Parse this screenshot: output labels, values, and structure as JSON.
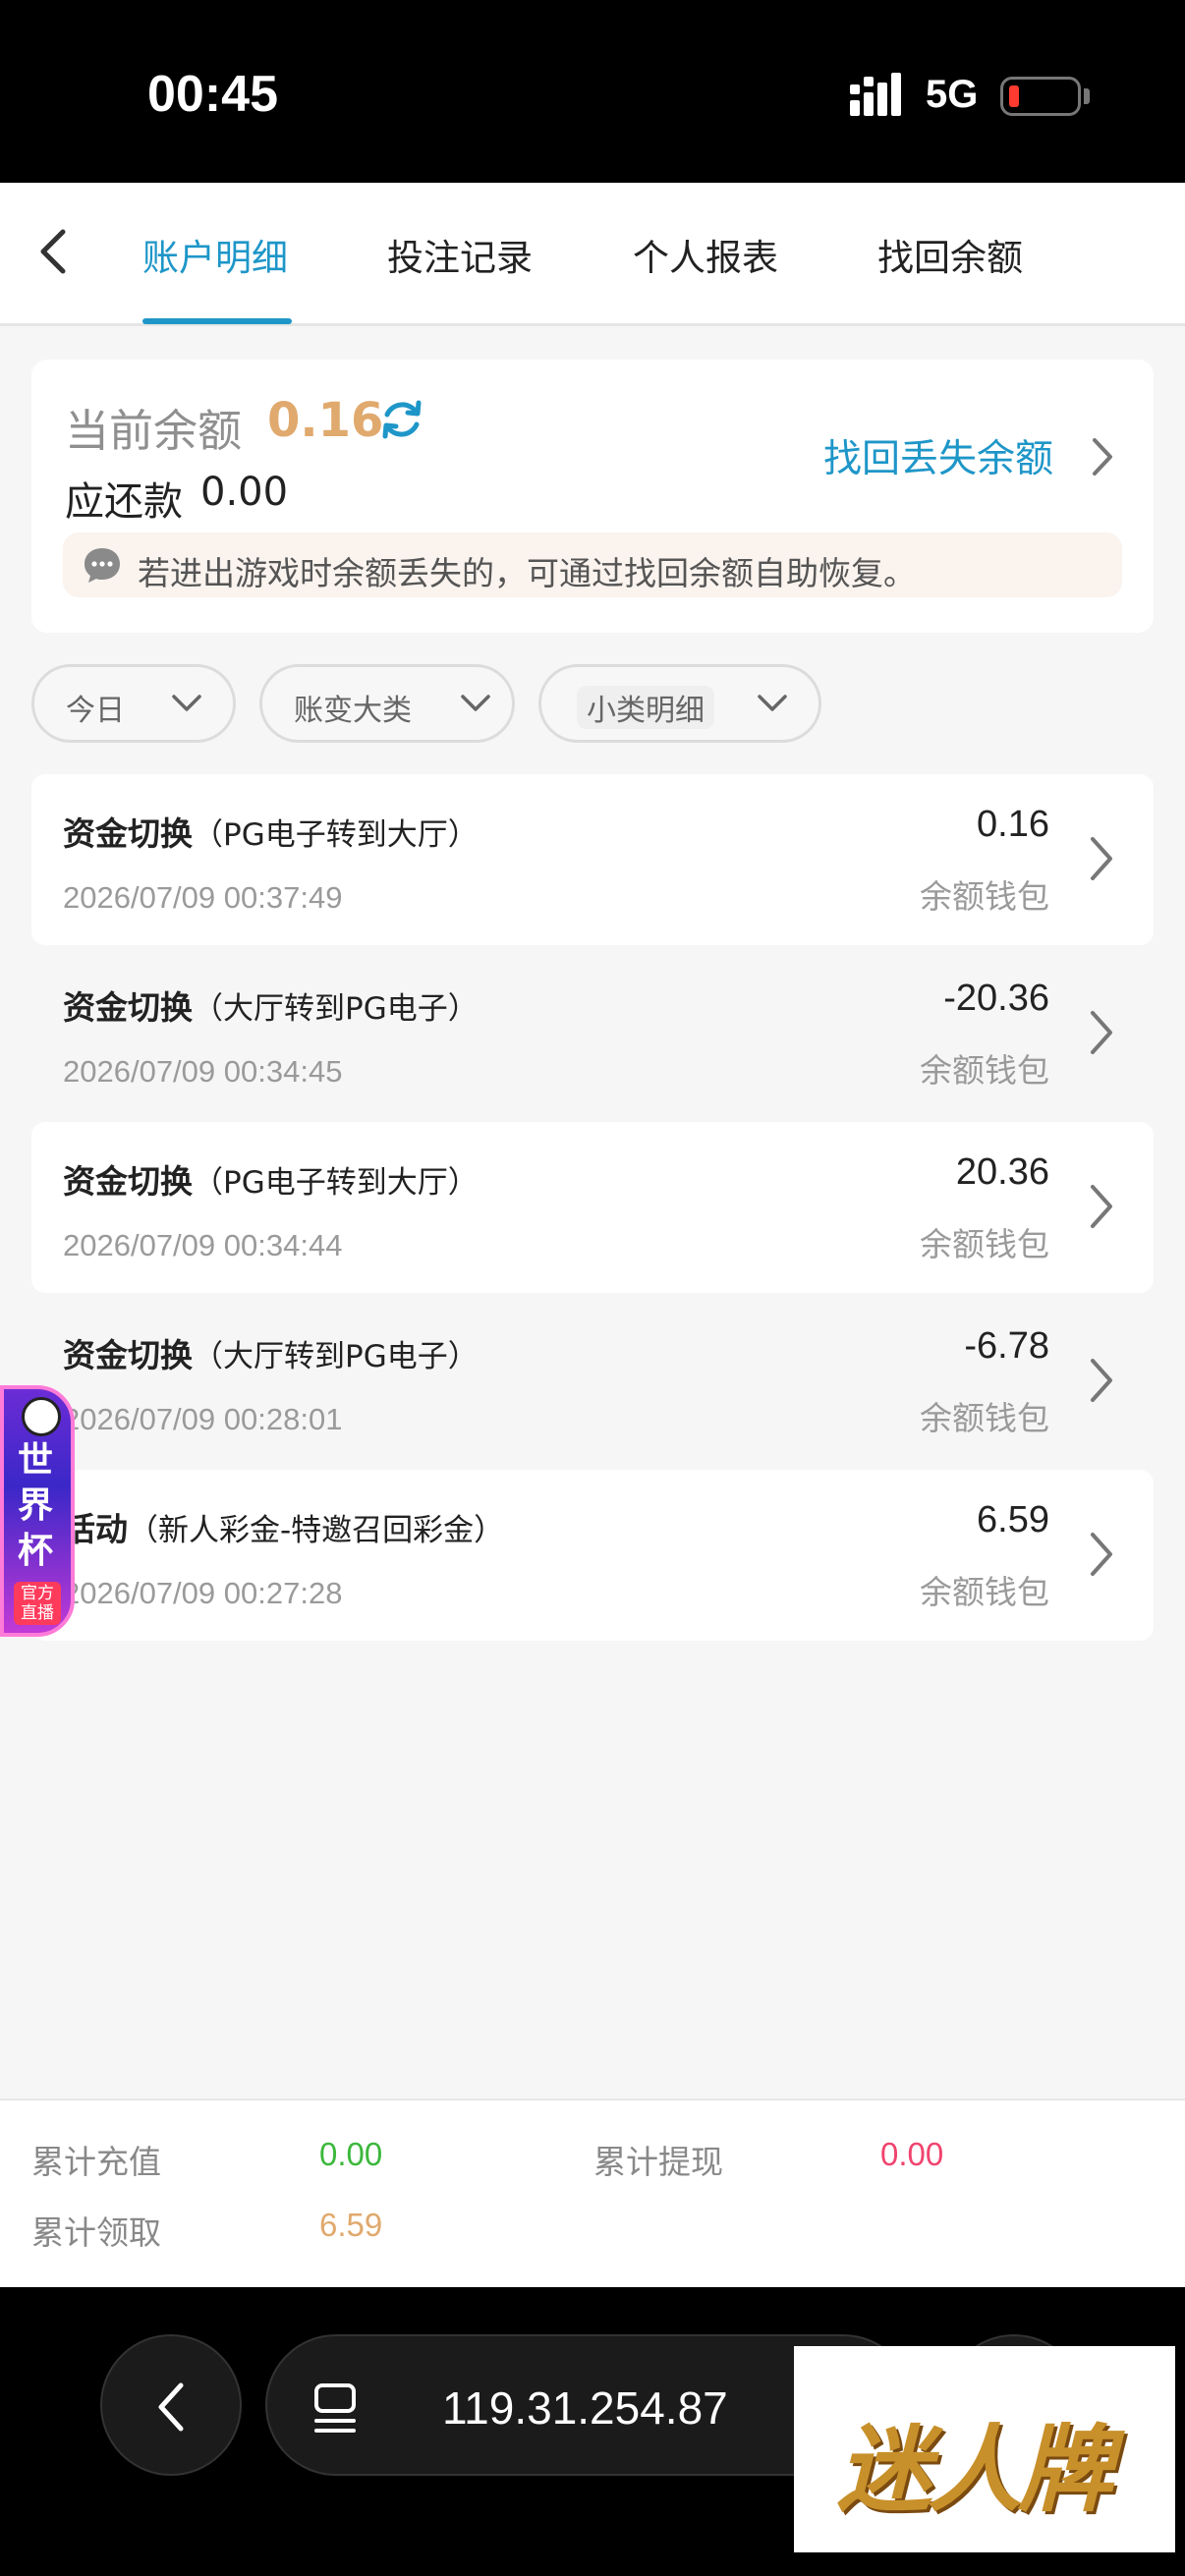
{
  "status_bar": {
    "time": "00:45",
    "network": "5G"
  },
  "nav": {
    "tabs": [
      {
        "label": "账户明细",
        "active": true
      },
      {
        "label": "投注记录",
        "active": false
      },
      {
        "label": "个人报表",
        "active": false
      },
      {
        "label": "找回余额",
        "active": false
      }
    ]
  },
  "balance_card": {
    "balance_label": "当前余额",
    "balance_value": "0.16",
    "repay_label": "应还款",
    "repay_value": "0.00",
    "recover_link": "找回丢失余额",
    "notice": "若进出游戏时余额丢失的，可通过找回余额自助恢复。"
  },
  "filters": [
    {
      "label": "今日"
    },
    {
      "label": "账变大类"
    },
    {
      "label": "小类明细"
    }
  ],
  "transactions": [
    {
      "type": "资金切换",
      "detail": "（PG电子转到大厅）",
      "date": "2026/07/09 00:37:49",
      "amount": "0.16",
      "wallet": "余额钱包"
    },
    {
      "type": "资金切换",
      "detail": "（大厅转到PG电子）",
      "date": "2026/07/09 00:34:45",
      "amount": "-20.36",
      "wallet": "余额钱包"
    },
    {
      "type": "资金切换",
      "detail": "（PG电子转到大厅）",
      "date": "2026/07/09 00:34:44",
      "amount": "20.36",
      "wallet": "余额钱包"
    },
    {
      "type": "资金切换",
      "detail": "（大厅转到PG电子）",
      "date": "2026/07/09 00:28:01",
      "amount": "-6.78",
      "wallet": "余额钱包"
    },
    {
      "type": "活动",
      "detail": "（新人彩金-特邀召回彩金）",
      "date": "2026/07/09 00:27:28",
      "amount": "6.59",
      "wallet": "余额钱包"
    }
  ],
  "floating_badge": {
    "line1": "世",
    "line2": "界",
    "line3": "杯",
    "live": "官方直播"
  },
  "summary": {
    "deposit_label": "累计充值",
    "deposit_value": "0.00",
    "deposit_color": "#3cb83c",
    "withdraw_label": "累计提现",
    "withdraw_value": "0.00",
    "withdraw_color": "#f0446e",
    "claim_label": "累计领取",
    "claim_value": "6.59",
    "claim_color": "#e0a96d"
  },
  "browser": {
    "address": "119.31.254.87"
  },
  "watermark": {
    "text": "迷人牌"
  },
  "colors": {
    "accent": "#1e96c8",
    "gold": "#e0a96d"
  }
}
